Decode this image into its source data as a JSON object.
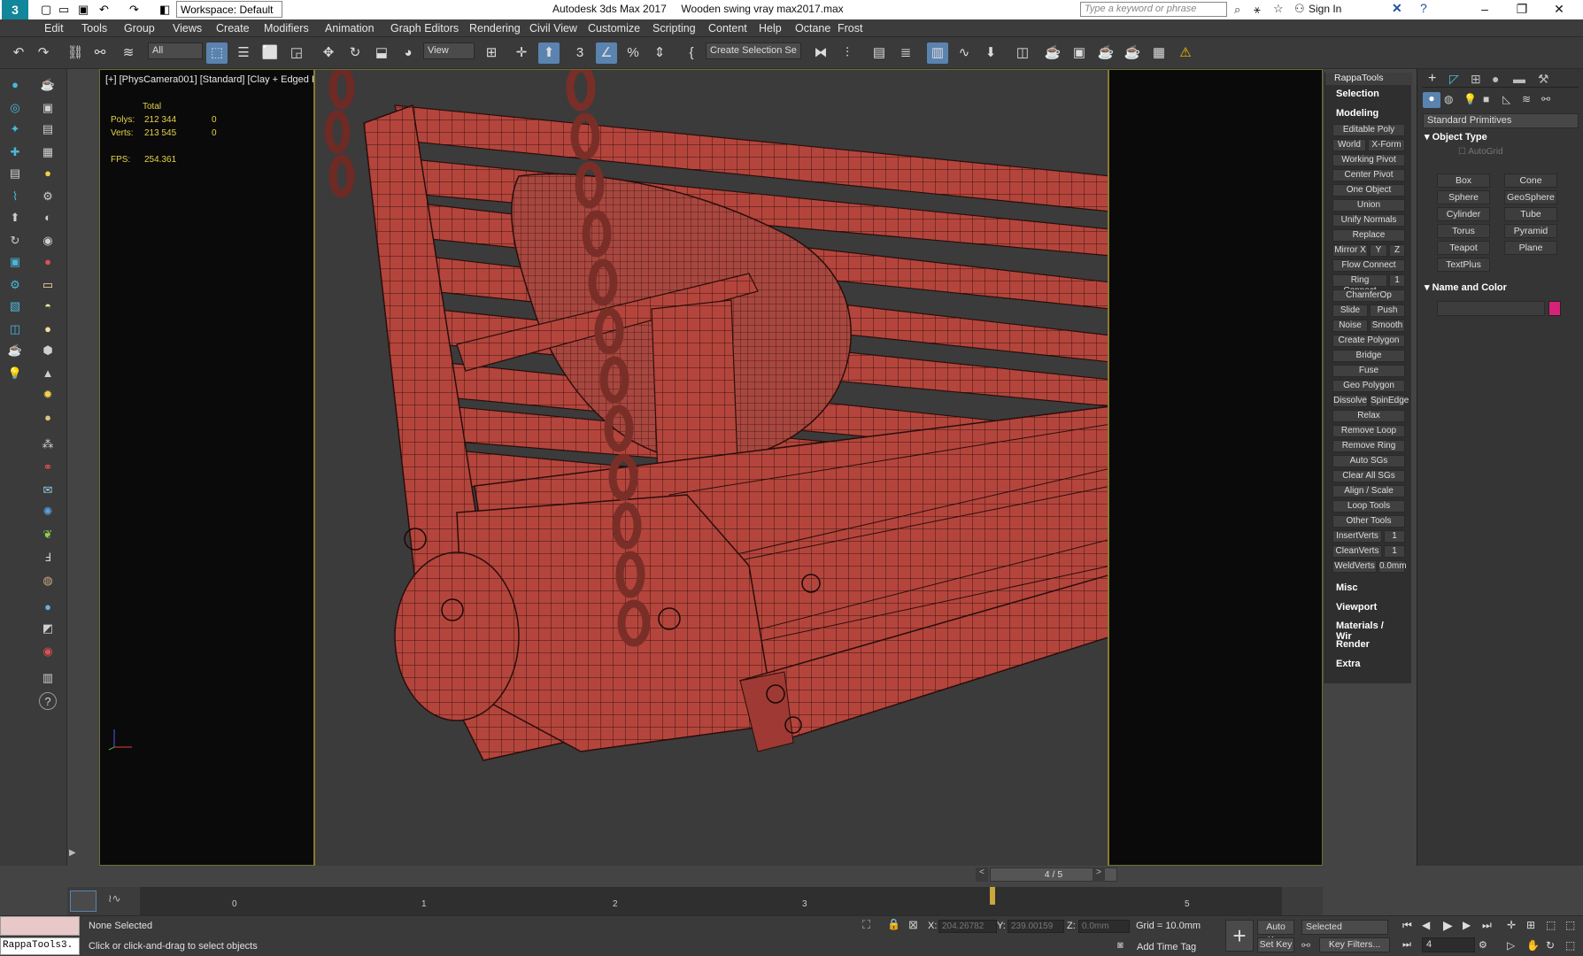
{
  "titlebar": {
    "workspace": "Workspace: Default",
    "app_title": "Autodesk 3ds Max 2017     Wooden swing vray max2017.max",
    "search_placeholder": "Type a keyword or phrase",
    "signin": "Sign In"
  },
  "menu": [
    "Edit",
    "Tools",
    "Group",
    "Views",
    "Create",
    "Modifiers",
    "Animation",
    "Graph Editors",
    "Rendering",
    "Civil View",
    "Customize",
    "Scripting",
    "Content",
    "Help",
    "Octane",
    "Frost"
  ],
  "toolbar": {
    "filter": "All",
    "refcoord": "View",
    "selection_set": "Create Selection Se"
  },
  "viewport": {
    "label": "[+] [PhysCamera001] [Standard] [Clay + Edged Faces]",
    "stats": {
      "total_label": "Total",
      "polys_label": "Polys:",
      "polys_value": "212 344",
      "polys_sel": "0",
      "verts_label": "Verts:",
      "verts_value": "213 545",
      "verts_sel": "0",
      "fps_label": "FPS:",
      "fps_value": "254.361"
    }
  },
  "rappatools": {
    "title": "RappaTools",
    "sections": {
      "selection": "Selection",
      "modeling": "Modeling",
      "misc": "Misc",
      "viewport": "Viewport",
      "materials": "Materials / Wir",
      "render": "Render",
      "extra": "Extra"
    },
    "buttons": [
      "Editable Poly",
      "World",
      "X-Form",
      "Working Pivot",
      "Center Pivot",
      "One Object",
      "Union",
      "Unify Normals",
      "Replace",
      "Mirror X",
      "Y",
      "Z",
      "Flow Connect",
      "Ring Connect",
      "1",
      "ChamferOp",
      "Slide",
      "Push",
      "Noise",
      "Smooth",
      "Create Polygon",
      "Bridge",
      "Fuse",
      "Geo Polygon",
      "Dissolve",
      "SpinEdge",
      "Relax",
      "Remove Loop",
      "Remove Ring",
      "Auto SGs",
      "Clear All SGs",
      "Align / Scale",
      "Loop Tools",
      "Other Tools",
      "InsertVerts",
      "1",
      "CleanVerts",
      "1",
      "WeldVerts",
      "0.0mm"
    ]
  },
  "command_panel": {
    "category": "Standard Primitives",
    "object_type": "Object Type",
    "autogrid": "AutoGrid",
    "objects": [
      "Box",
      "Cone",
      "Sphere",
      "GeoSphere",
      "Cylinder",
      "Tube",
      "Torus",
      "Pyramid",
      "Teapot",
      "Plane",
      "TextPlus"
    ],
    "name_and_color": "Name and Color",
    "color": "#d6237a"
  },
  "timeline": {
    "frame": "4 / 5",
    "ticks": [
      "0",
      "1",
      "2",
      "3",
      "4",
      "5"
    ],
    "current_frame": 4,
    "total_frames": 5
  },
  "status": {
    "script_listener": "RappaTools3.",
    "selection": "None Selected",
    "prompt": "Click or click-and-drag to select objects",
    "x_label": "X:",
    "x_value": "204.26782",
    "y_label": "Y:",
    "y_value": "239.00159",
    "z_label": "Z:",
    "z_value": "0.0mm",
    "grid": "Grid = 10.0mm",
    "add_time_tag": "Add Time Tag",
    "auto_key": "Auto Key",
    "selected": "Selected",
    "set_key": "Set Key",
    "key_filters": "Key Filters...",
    "frame_field": "4"
  }
}
